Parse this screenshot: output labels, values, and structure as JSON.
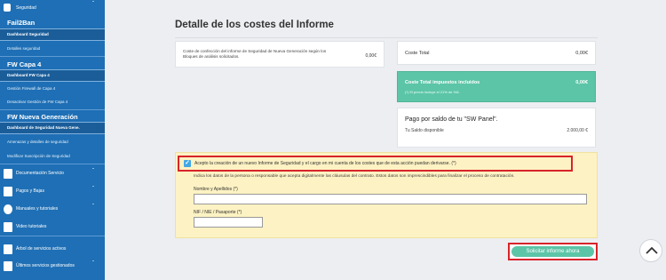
{
  "sidebar": {
    "top_item": "Seguridad",
    "sections": [
      {
        "title": "Fail2Ban",
        "active": "Dashboard Seguridad",
        "links": [
          "Detalles seguridad"
        ]
      },
      {
        "title": "FW Capa 4",
        "active": "Dashboard FW Capa 4",
        "links": [
          "Gestión Firewall de Capa 4",
          "Desactivar Gestión de FW Capa 4"
        ]
      },
      {
        "title": "FW Nueva Generación",
        "active": "Dashboard de Seguridad Nueva Gene.",
        "links": [
          "Amenazas y detalles de seguridad",
          "Modificar Suscripción de Seguridad"
        ]
      }
    ],
    "main_items": [
      {
        "label": "Documentación Servicio",
        "icon": "document-icon"
      },
      {
        "label": "Pagos y Bajas",
        "icon": "payments-icon"
      },
      {
        "label": "Manuales y tutoriales",
        "icon": "help-icon"
      },
      {
        "label": "Video tutoriales",
        "icon": "video-icon"
      },
      {
        "label": "Árbol de servicios activos",
        "icon": "tree-icon"
      },
      {
        "label": "Últimos servicios gestionados",
        "icon": "history-icon"
      }
    ]
  },
  "main": {
    "title": "Detalle de los costes del Informe",
    "confection_text": "Coste de confección del informe de Seguridad de Nueva Generación según los Bloques de análisis solicitados.",
    "confection_value": "0,00€",
    "cost_total_label": "Coste Total",
    "cost_total_value": "0,00€",
    "tax_label": "Coste Total impuestos incluidos",
    "tax_value": "0,00€",
    "tax_note": "(*) El precio incluye el 21% de IVA.",
    "pay_title": "Pago por saldo de tu \"SW Panel\".",
    "balance_label": "Tu Saldo disponible",
    "balance_value": "2.000,00 €",
    "accept_text": "Acepto la creación de un nuevo Informe de Seguridad y el cargo en mi cuenta de los costes que de esta acción puedan derivarse. (*)",
    "indica_text": "Indica los datos de la persona o responsable que acepta digitalmente las cláusulas del contrato. Estos datos son imprescindibles para finalizar el proceso de contratación.",
    "name_label": "Nombre y Apellidos (*)",
    "name_value": "",
    "nif_label": "NIF / NIE / Pasaporte (*)",
    "nif_value": "",
    "request_button": "Solicitar informe ahora"
  },
  "colors": {
    "sidebar": "#1e6fb5",
    "accent_green": "#5cc5a7",
    "highlight_red": "#d8232a",
    "panel_yellow": "#fdf2c3"
  }
}
